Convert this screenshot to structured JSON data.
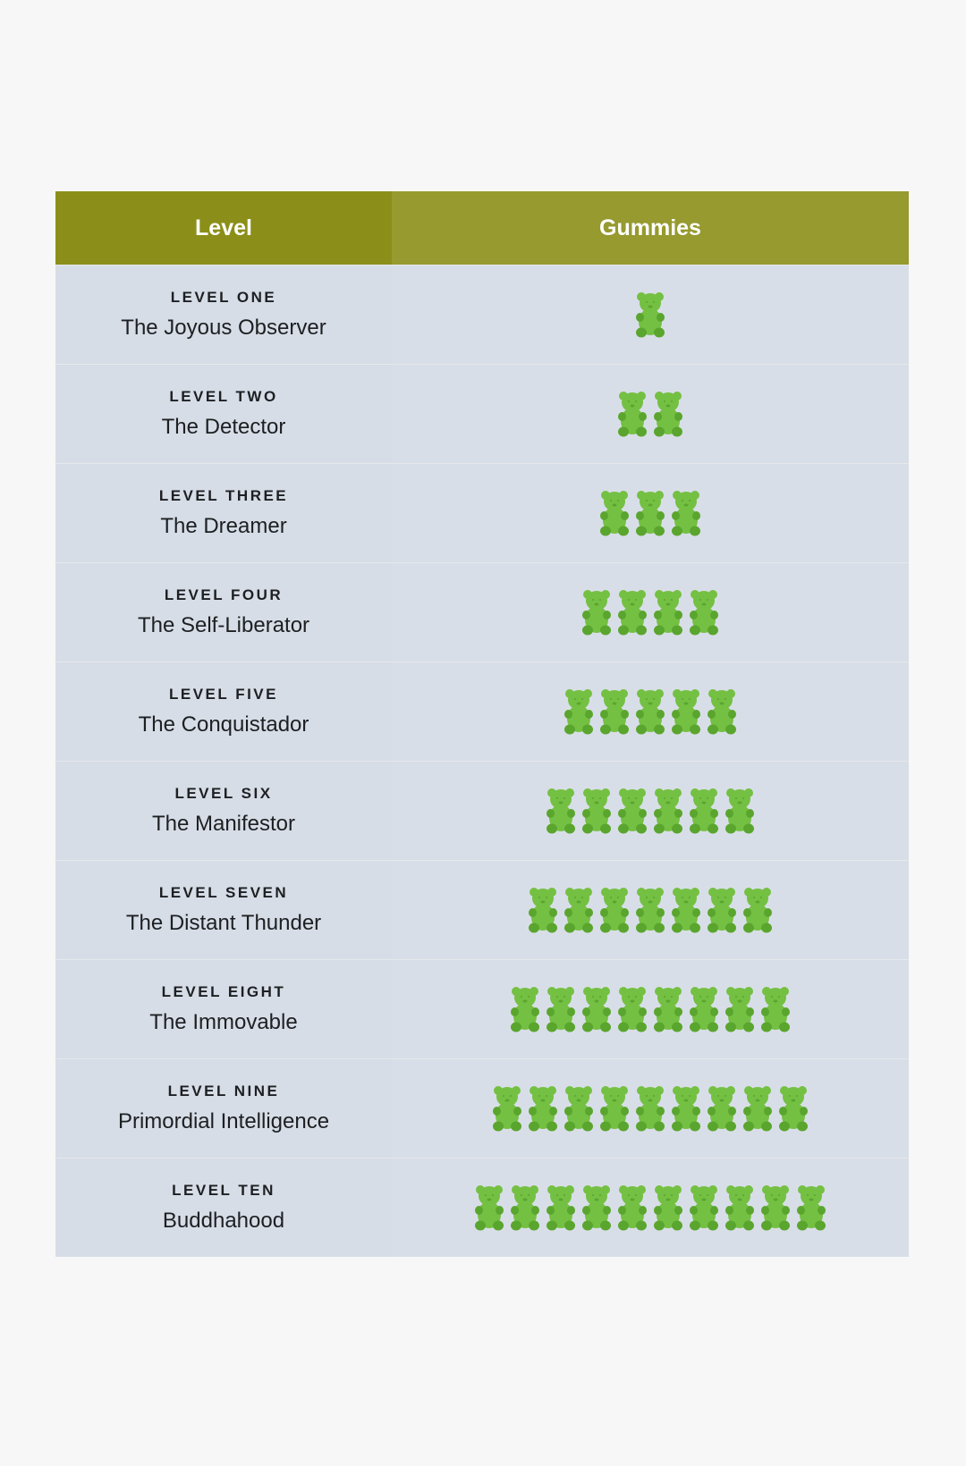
{
  "header": {
    "level": "Level",
    "gummies": "Gummies"
  },
  "colors": {
    "header_left": "#8b8f1a",
    "header_right": "#969a2f",
    "row_bg": "#d6dde6",
    "bear_body": "#74c043",
    "bear_shade": "#5aa52e"
  },
  "icon": "gummy-bear-icon",
  "rows": [
    {
      "label": "LEVEL ONE",
      "name": "The Joyous Observer",
      "gummies": 1
    },
    {
      "label": "LEVEL TWO",
      "name": "The Detector",
      "gummies": 2
    },
    {
      "label": "LEVEL THREE",
      "name": "The Dreamer",
      "gummies": 3
    },
    {
      "label": "LEVEL FOUR",
      "name": "The Self-Liberator",
      "gummies": 4
    },
    {
      "label": "LEVEL FIVE",
      "name": "The Conquistador",
      "gummies": 5
    },
    {
      "label": "LEVEL SIX",
      "name": "The Manifestor",
      "gummies": 6
    },
    {
      "label": "LEVEL SEVEN",
      "name": "The Distant Thunder",
      "gummies": 7
    },
    {
      "label": "LEVEL EIGHT",
      "name": "The Immovable",
      "gummies": 8
    },
    {
      "label": "LEVEL NINE",
      "name": "Primordial Intelligence",
      "gummies": 9
    },
    {
      "label": "LEVEL TEN",
      "name": "Buddhahood",
      "gummies": 10
    }
  ]
}
